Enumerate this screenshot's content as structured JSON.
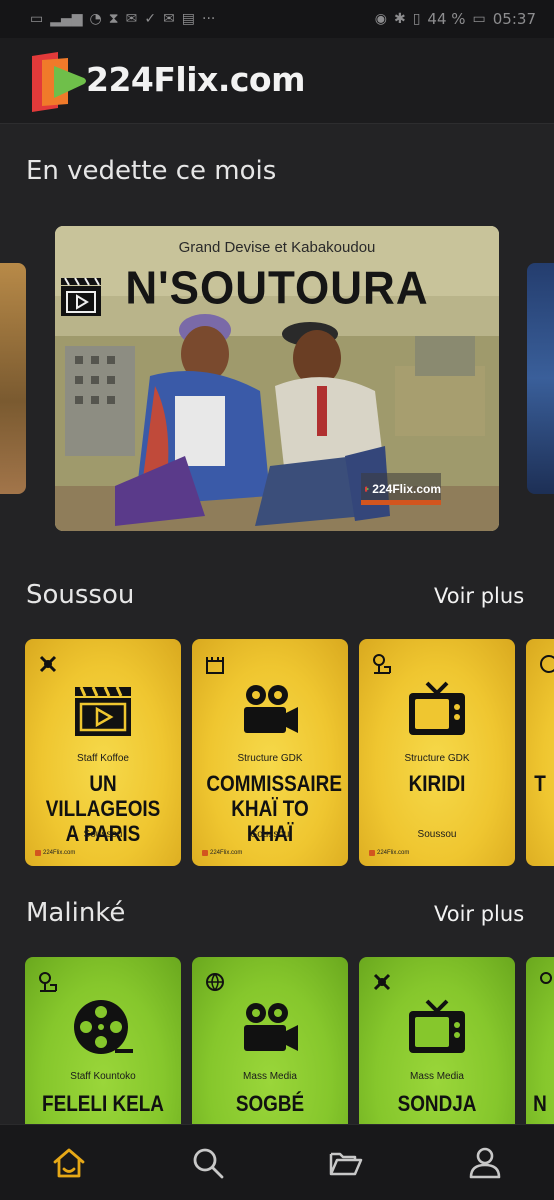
{
  "status_bar": {
    "battery": "44 %",
    "time": "05:37"
  },
  "app": {
    "logo_text": "224Flix.com"
  },
  "featured": {
    "section_title": "En vedette ce mois",
    "card": {
      "subtitle": "Grand Devise et Kabakoudou",
      "title": "N'SOUTOURA",
      "watermark": "224Flix.com"
    }
  },
  "rows": [
    {
      "title": "Soussou",
      "see_more": "Voir plus",
      "items": [
        {
          "studio": "Staff Koffoe",
          "title": "UN VILLAGEOIS A PARIS",
          "lang": "Soussou",
          "brand": "224Flix.com",
          "icon": "clapperboard-icon",
          "small_icon": "tools-icon"
        },
        {
          "studio": "Structure GDK",
          "title": "COMMISSAIRE KHAÏ TO KHAÏ",
          "lang": "Soussou",
          "brand": "224Flix.com",
          "icon": "movie-camera-icon",
          "small_icon": "castle-icon"
        },
        {
          "studio": "Structure GDK",
          "title": "KIRIDI",
          "lang": "Soussou",
          "brand": "224Flix.com",
          "icon": "tv-icon",
          "small_icon": "park-icon"
        },
        {
          "title": "T"
        }
      ]
    },
    {
      "title": "Malinké",
      "see_more": "Voir plus",
      "items": [
        {
          "studio": "Staff Kountoko",
          "title": "FELELI KELA",
          "icon": "film-reel-icon",
          "small_icon": "park-icon"
        },
        {
          "studio": "Mass Media",
          "title": "SOGBÉ",
          "icon": "movie-camera-icon",
          "small_icon": "globe-icon"
        },
        {
          "studio": "Mass Media",
          "title": "SONDJA",
          "icon": "tv-icon",
          "small_icon": "tools-icon"
        },
        {
          "title": "N"
        }
      ]
    }
  ],
  "bottom_nav": {
    "items": [
      {
        "icon": "home-icon",
        "active": true
      },
      {
        "icon": "search-icon",
        "active": false
      },
      {
        "icon": "folder-icon",
        "active": false
      },
      {
        "icon": "user-icon",
        "active": false
      }
    ],
    "active_color": "#e6a817",
    "inactive_color": "#c8c8c8"
  },
  "colors": {
    "background": "#232325",
    "poster_soussou": "#efc630",
    "poster_malinke": "#86c72c",
    "brand_orange": "#d2551f",
    "brand_red": "#e23a3a",
    "brand_green": "#6fbf4a"
  }
}
